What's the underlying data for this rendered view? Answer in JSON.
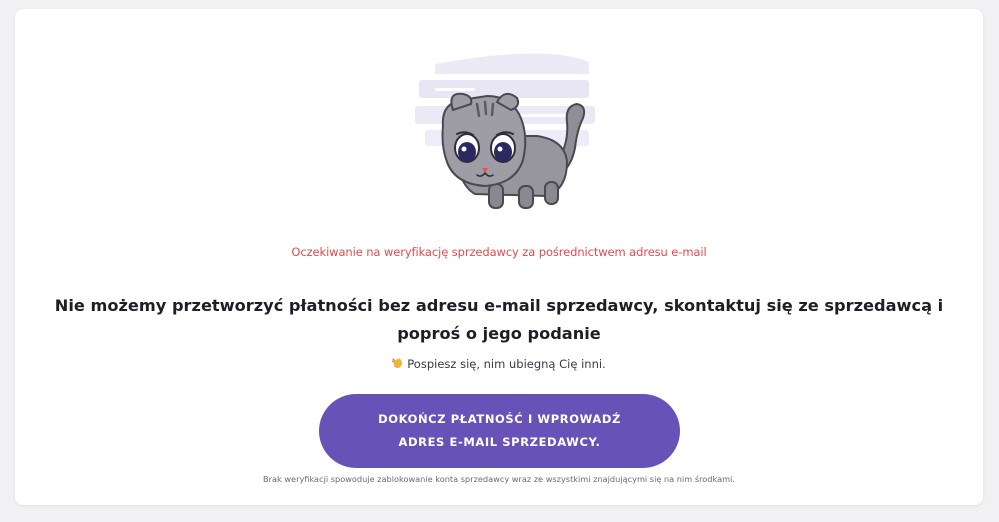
{
  "status": {
    "text": "Oczekiwanie na weryfikację sprzedawcy za pośrednictwem adresu e-mail"
  },
  "message": {
    "line1": "Nie możemy przetworzyć płatności bez adresu e-mail sprzedawcy, skontaktuj się ze sprzedawcą i",
    "line2": "poproś o jego podanie"
  },
  "hurry": {
    "icon": "hand-icon",
    "text": "Pospiesz się, nim ubiegną Cię inni."
  },
  "cta": {
    "line1": "DOKOŃCZ PŁATNOŚĆ I WPROWADŹ",
    "line2": "ADRES E-MAIL SPRZEDAWCY."
  },
  "warning": {
    "text": "Brak weryfikacji spowoduje zablokowanie konta sprzedawcy wraz ze wszystkimi znajdującymi się na nim środkami."
  },
  "colors": {
    "accent": "#6753b8",
    "status": "#e04b4b",
    "background": "#f1f1f3"
  }
}
